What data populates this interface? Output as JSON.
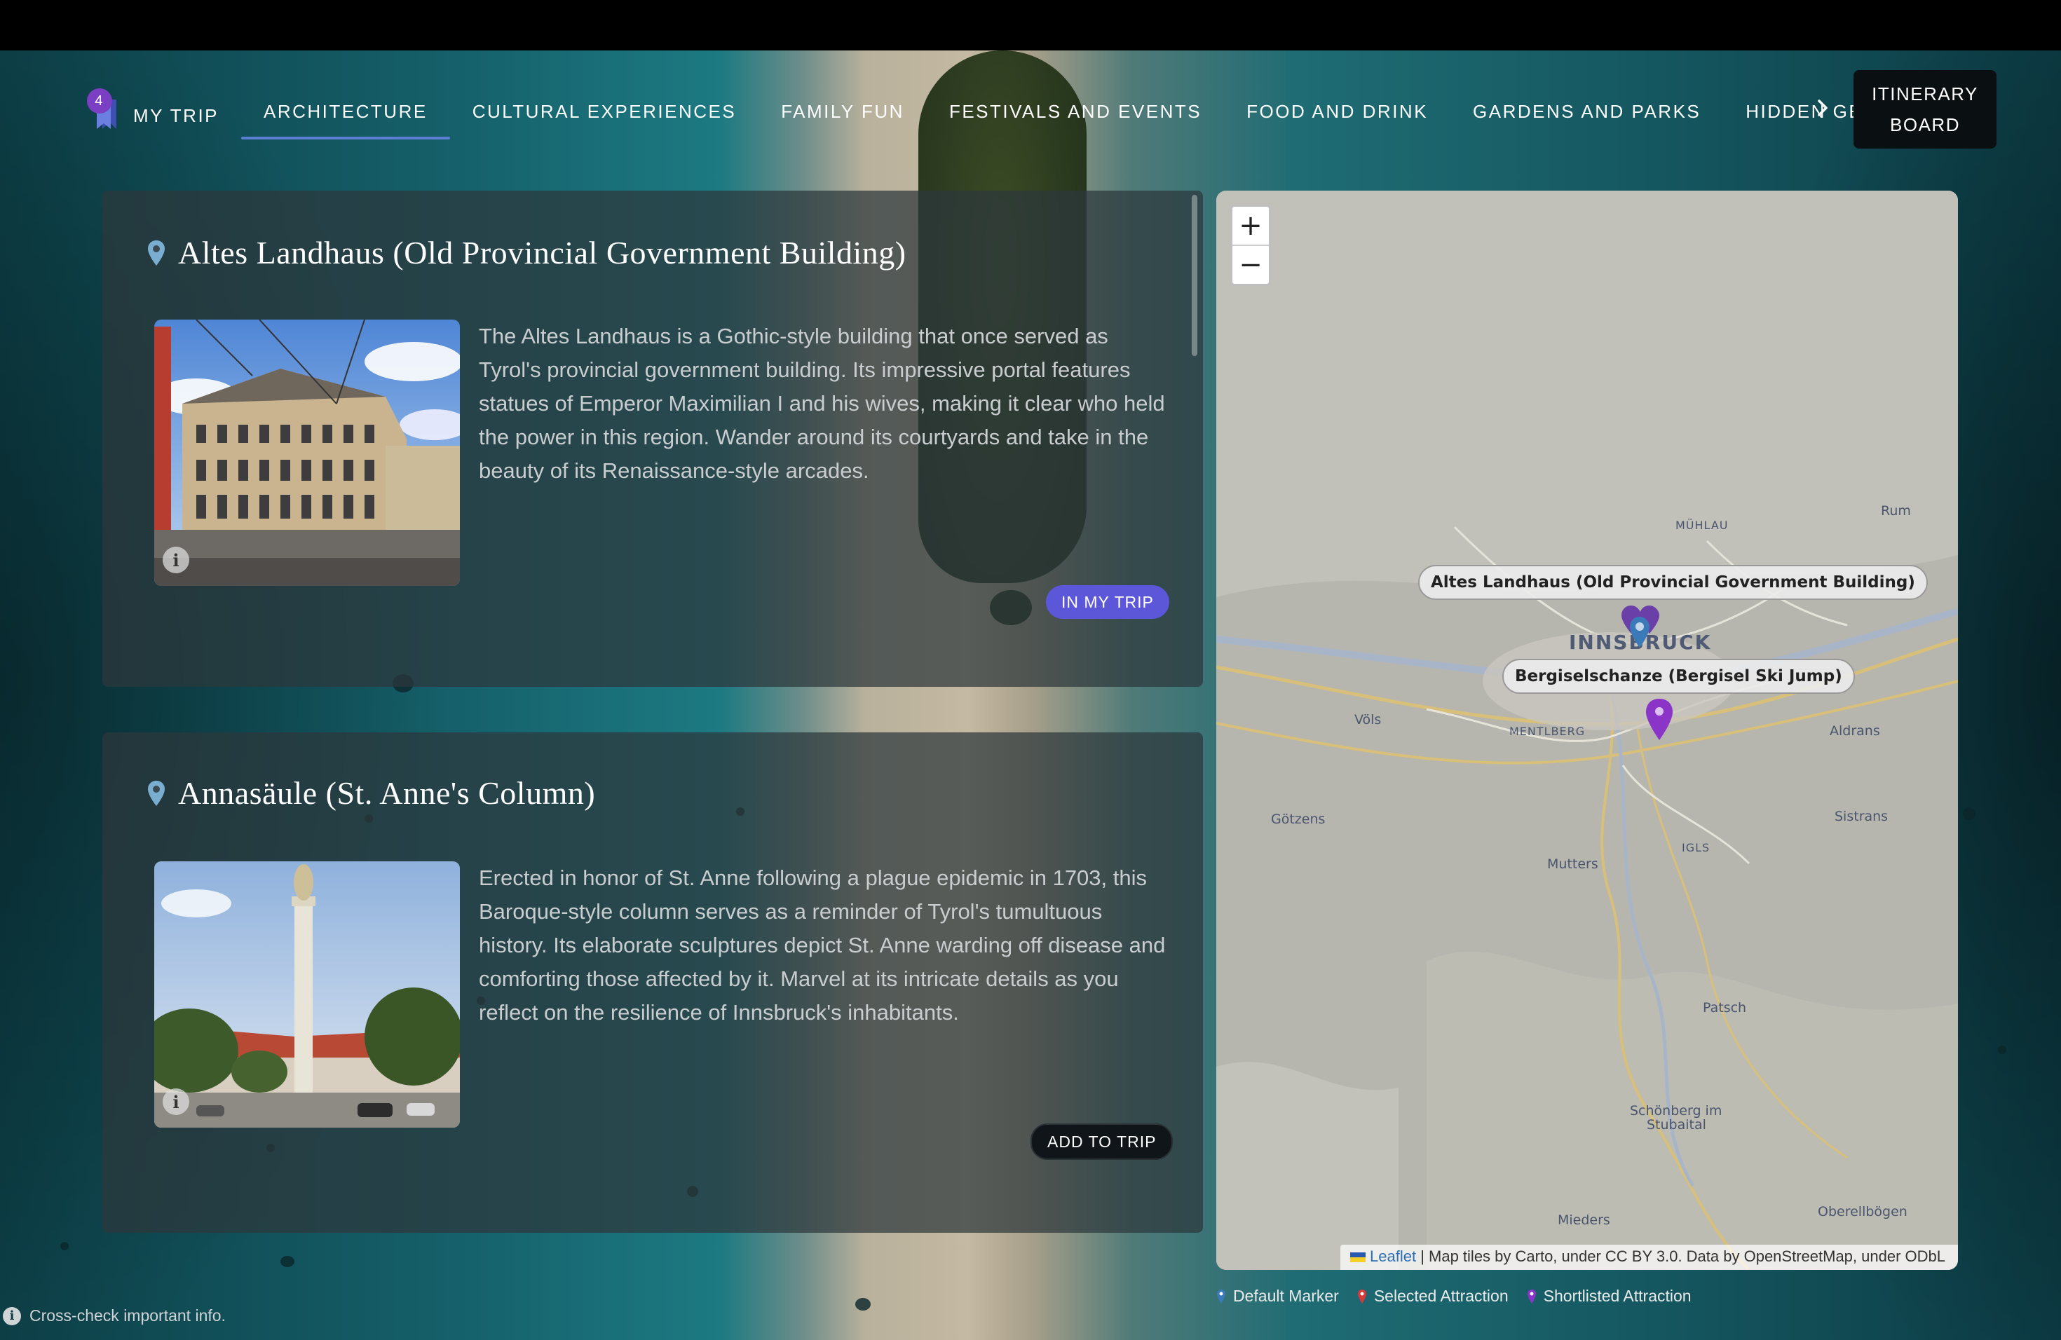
{
  "nav": {
    "trip_count": "4",
    "my_trip_label": "MY TRIP",
    "tabs": [
      {
        "label": "ARCHITECTURE",
        "active": true
      },
      {
        "label": "CULTURAL EXPERIENCES"
      },
      {
        "label": "FAMILY FUN"
      },
      {
        "label": "FESTIVALS AND EVENTS"
      },
      {
        "label": "FOOD AND DRINK"
      },
      {
        "label": "GARDENS AND PARKS"
      },
      {
        "label": "HIDDEN GE"
      }
    ],
    "more_icon": "chevron-right-icon",
    "itinerary_line1": "ITINERARY",
    "itinerary_line2": "BOARD"
  },
  "attractions": [
    {
      "title": "Altes Landhaus (Old Provincial Government Building)",
      "description": "The Altes Landhaus is a Gothic-style building that once served as Tyrol's provincial government building. Its impressive portal features statues of Emperor Maximilian I and his wives, making it clear who held the power in this region. Wander around its courtyards and take in the beauty of its Renaissance-style arcades.",
      "button": "IN MY TRIP",
      "in_trip": true
    },
    {
      "title": "Annasäule (St. Anne's Column)",
      "description": "Erected in honor of St. Anne following a plague epidemic in 1703, this Baroque-style column serves as a reminder of Tyrol's tumultuous history. Its elaborate sculptures depict St. Anne warding off disease and comforting those affected by it. Marvel at its intricate details as you reflect on the resilience of Innsbruck's inhabitants.",
      "button": "ADD TO TRIP",
      "in_trip": false
    }
  ],
  "map": {
    "zoom_in": "+",
    "zoom_out": "−",
    "places": {
      "muhlau": "MÜHLAU",
      "rum": "Rum",
      "innsbruck": "INNSBRUCK",
      "vols": "Völs",
      "mentlberg": "MENTLBERG",
      "aldrans": "Aldrans",
      "gotzens": "Götzens",
      "sistrans": "Sistrans",
      "igls": "IGLS",
      "mutters": "Mutters",
      "patsch": "Patsch",
      "schonberg1": "Schönberg im",
      "schonberg2": "Stubaital",
      "oberellbogen": "Oberellbögen",
      "mieders": "Mieders"
    },
    "tooltip1": "Altes Landhaus (Old Provincial Government Building)",
    "tooltip2": "Bergiselschanze (Bergisel Ski Jump)",
    "attrib_link": "Leaflet",
    "attrib_text": " | Map tiles by Carto, under CC BY 3.0. Data by OpenStreetMap, under ODbL",
    "colors": {
      "default": "#3b7ab8",
      "selected": "#d33b3b",
      "shortlisted": "#8a35c8"
    }
  },
  "legend": {
    "default": "Default Marker",
    "selected": "Selected Attraction",
    "shortlisted": "Shortlisted Attraction"
  },
  "footer_note": "Cross-check important info."
}
